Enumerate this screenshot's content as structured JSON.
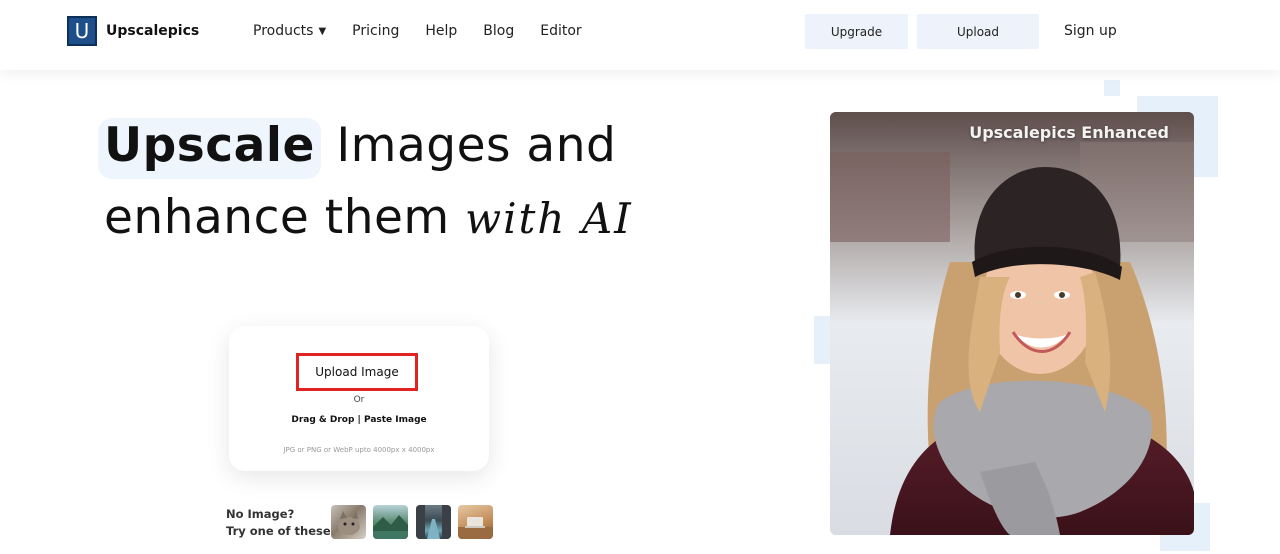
{
  "header": {
    "logo_letter": "U",
    "brand": "Upscalepics",
    "nav": [
      {
        "label": "Products",
        "icon": "caret-down-icon"
      },
      {
        "label": "Pricing"
      },
      {
        "label": "Help"
      },
      {
        "label": "Blog"
      },
      {
        "label": "Editor"
      }
    ],
    "upgrade_label": "Upgrade",
    "upload_label": "Upload",
    "signup_label": "Sign up"
  },
  "hero": {
    "highlight": "Upscale",
    "line1_rest": "Images and",
    "line2_main": "enhance them",
    "line2_script": "with AI"
  },
  "upload_card": {
    "button_label": "Upload Image",
    "or_text": "Or",
    "drag_text": "Drag & Drop | Paste Image",
    "formats_text": "JPG or PNG or WebP upto 4000px x 4000px"
  },
  "samples": {
    "line1": "No Image?",
    "line2": "Try one of these :",
    "thumbnails": [
      "cat-thumbnail",
      "landscape-thumbnail",
      "street-thumbnail",
      "desk-thumbnail"
    ]
  },
  "showcase": {
    "label": "Upscalepics Enhanced"
  },
  "colors": {
    "brand_blue": "#1e4f8a",
    "button_bg": "#eef3fb",
    "highlight_bg": "#eef5fd",
    "upload_border": "#e02424"
  }
}
